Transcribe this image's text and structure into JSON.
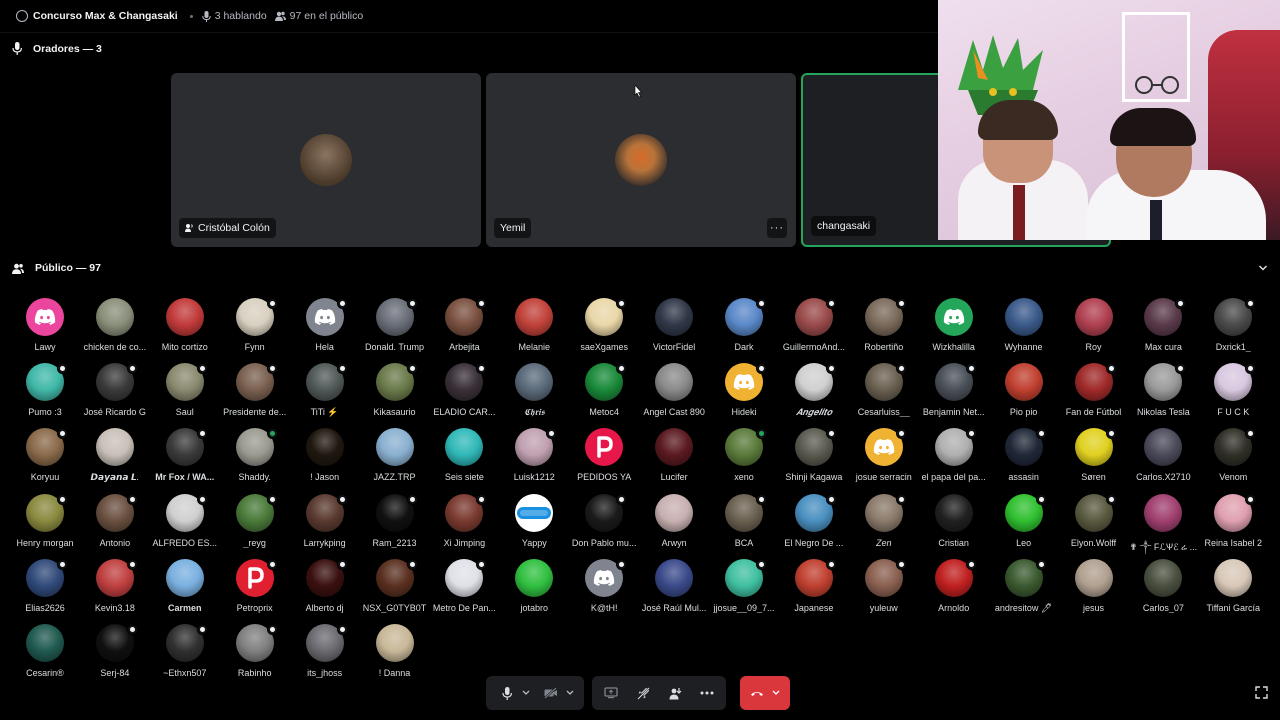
{
  "stage": {
    "title": "Concurso Max & Changasaki",
    "speaking": "3 hablando",
    "audience": "97 en el público"
  },
  "speakers_header": "Oradores — 3",
  "audience_header": "Público — 97",
  "speakers": [
    {
      "name": "Cristóbal Colón",
      "color": "#5a4a3a",
      "has_more": false,
      "active": false
    },
    {
      "name": "Yemil",
      "color": "#b8743a",
      "has_more": true,
      "active": false
    },
    {
      "name": "changasaki",
      "color": "#3a3a3a",
      "has_more": false,
      "active": true
    }
  ],
  "audience": [
    {
      "name": "Lawy",
      "color": "#eb459e",
      "icon": "discord",
      "badge": "none"
    },
    {
      "name": "chicken de co...",
      "color": "#8a8f7a",
      "icon": "photo",
      "badge": "none"
    },
    {
      "name": "Mito cortizo",
      "color": "#c23a3a",
      "icon": "photo",
      "badge": "none"
    },
    {
      "name": "Fynn",
      "color": "#d8d0c0",
      "icon": "photo",
      "badge": "muted"
    },
    {
      "name": "Hela",
      "color": "#80848e",
      "icon": "discord",
      "badge": "muted"
    },
    {
      "name": "Donald. Trump",
      "color": "#6a6e78",
      "icon": "photo",
      "badge": "muted"
    },
    {
      "name": "Arbejita",
      "color": "#7a5040",
      "icon": "photo",
      "badge": "muted"
    },
    {
      "name": "Melanie",
      "color": "#c0423a",
      "icon": "photo",
      "badge": "none"
    },
    {
      "name": "saeXgames",
      "color": "#e9d7a8",
      "icon": "photo",
      "badge": "muted"
    },
    {
      "name": "VictorFidel",
      "color": "#303848",
      "icon": "photo",
      "badge": "none"
    },
    {
      "name": "Dark",
      "color": "#5a88c8",
      "icon": "photo",
      "badge": "muted"
    },
    {
      "name": "GuillermoAnd...",
      "color": "#9a4a4a",
      "icon": "photo",
      "badge": "muted"
    },
    {
      "name": "Robertiño",
      "color": "#7a6a5a",
      "icon": "photo",
      "badge": "muted"
    },
    {
      "name": "Wizkhalilla",
      "color": "#23a55a",
      "icon": "discord",
      "badge": "none"
    },
    {
      "name": "Wyhanne",
      "color": "#3a5a8a",
      "icon": "photo",
      "badge": "none"
    },
    {
      "name": "Roy",
      "color": "#b04050",
      "icon": "photo",
      "badge": "none"
    },
    {
      "name": "Max cura",
      "color": "#5a3a4a",
      "icon": "photo",
      "badge": "muted"
    },
    {
      "name": "Dxrick1_",
      "color": "#4a4a4a",
      "icon": "photo",
      "badge": "muted"
    },
    {
      "name": "Pumo :3",
      "color": "#40b8a8",
      "icon": "photo",
      "badge": "muted"
    },
    {
      "name": "José Ricardo G",
      "color": "#3a3a3a",
      "icon": "photo",
      "badge": "muted"
    },
    {
      "name": "Saul",
      "color": "#8a8a70",
      "icon": "photo",
      "badge": "muted"
    },
    {
      "name": "Presidente de...",
      "color": "#7a6050",
      "icon": "photo",
      "badge": "muted"
    },
    {
      "name": "TiTi ⚡",
      "color": "#505858",
      "icon": "photo",
      "badge": "muted"
    },
    {
      "name": "Kikasaurio",
      "color": "#6a7a4a",
      "icon": "photo",
      "badge": "muted"
    },
    {
      "name": "ELADIO CAR...",
      "color": "#3a3038",
      "icon": "photo",
      "badge": "muted"
    },
    {
      "name": "𝕮𝖍𝖗𝖎𝖘",
      "color": "#5a6a7a",
      "icon": "photo",
      "badge": "none"
    },
    {
      "name": "Metoc4",
      "color": "#1a8a3a",
      "icon": "photo",
      "badge": "muted"
    },
    {
      "name": "Angel Cast 890",
      "color": "#8a8a8a",
      "icon": "photo",
      "badge": "none"
    },
    {
      "name": "Hideki",
      "color": "#f0b232",
      "icon": "discord",
      "badge": "muted"
    },
    {
      "name": "𝑨𝒏𝒈𝒆𝒍𝒊𝒕𝒐",
      "color": "#d0d0d0",
      "icon": "photo",
      "badge": "muted"
    },
    {
      "name": "Cesarluiss__",
      "color": "#6a6050",
      "icon": "photo",
      "badge": "muted"
    },
    {
      "name": "Benjamin Net...",
      "color": "#4a5058",
      "icon": "photo",
      "badge": "muted"
    },
    {
      "name": "Pio pio",
      "color": "#c04030",
      "icon": "photo",
      "badge": "none"
    },
    {
      "name": "Fan de Fútbol",
      "color": "#a02a2a",
      "icon": "photo",
      "badge": "muted"
    },
    {
      "name": "Nikolas Tesla",
      "color": "#9a9a9a",
      "icon": "photo",
      "badge": "muted"
    },
    {
      "name": "F U C K",
      "color": "#d8c8e0",
      "icon": "photo",
      "badge": "muted"
    },
    {
      "name": "Koryuu",
      "color": "#8a6a4a",
      "icon": "photo",
      "badge": "muted"
    },
    {
      "name": "𝘿𝙖𝙮𝙖𝙣𝙖 𝙇.",
      "color": "#c8c0b8",
      "icon": "photo",
      "badge": "none"
    },
    {
      "name": "Mr Fox / WA...",
      "color": "#3a3a3a",
      "icon": "photo",
      "badge": "muted"
    },
    {
      "name": "Shaddy.",
      "color": "#9a9a90",
      "icon": "photo",
      "badge": "green"
    },
    {
      "name": "! Jason",
      "color": "#201810",
      "icon": "photo",
      "badge": "none"
    },
    {
      "name": "JAZZ.TRP",
      "color": "#8ab0d0",
      "icon": "photo",
      "badge": "none"
    },
    {
      "name": "Seis siete",
      "color": "#30b8b8",
      "icon": "photo",
      "badge": "none"
    },
    {
      "name": "Luisk1212",
      "color": "#c0a0b0",
      "icon": "photo",
      "badge": "muted"
    },
    {
      "name": "PEDIDOS YA",
      "color": "#e8174a",
      "icon": "letter-p",
      "badge": "none"
    },
    {
      "name": "Lucifer",
      "color": "#5a1a20",
      "icon": "photo",
      "badge": "none"
    },
    {
      "name": "xeno",
      "color": "#5a7a3a",
      "icon": "photo",
      "badge": "green"
    },
    {
      "name": "Shinji Kagawa",
      "color": "#5a5a50",
      "icon": "photo",
      "badge": "muted"
    },
    {
      "name": "josue serracin",
      "color": "#f0b232",
      "icon": "discord",
      "badge": "muted"
    },
    {
      "name": "el papa del pa...",
      "color": "#b0b0b0",
      "icon": "photo",
      "badge": "muted"
    },
    {
      "name": "assasin",
      "color": "#202838",
      "icon": "photo",
      "badge": "muted"
    },
    {
      "name": "Søren",
      "color": "#e0d020",
      "icon": "photo",
      "badge": "muted"
    },
    {
      "name": "Carlos.X2710",
      "color": "#4a4a5a",
      "icon": "photo",
      "badge": "none"
    },
    {
      "name": "Venom",
      "color": "#303028",
      "icon": "photo",
      "badge": "muted"
    },
    {
      "name": "Henry morgan",
      "color": "#8a8a40",
      "icon": "photo",
      "badge": "muted"
    },
    {
      "name": "Antonio",
      "color": "#6a5040",
      "icon": "photo",
      "badge": "muted"
    },
    {
      "name": "ALFREDO ES...",
      "color": "#d0d0d0",
      "icon": "photo",
      "badge": "muted"
    },
    {
      "name": "_reyg",
      "color": "#4a7a3a",
      "icon": "photo",
      "badge": "muted"
    },
    {
      "name": "Larrykping",
      "color": "#5a3a30",
      "icon": "photo",
      "badge": "muted"
    },
    {
      "name": "Ram_2213",
      "color": "#101010",
      "icon": "photo",
      "badge": "muted"
    },
    {
      "name": "Xi Jimping",
      "color": "#7a3a30",
      "icon": "photo",
      "badge": "muted"
    },
    {
      "name": "Yappy",
      "color": "#ffffff",
      "icon": "yappy",
      "badge": "none"
    },
    {
      "name": "Don Pablo mu...",
      "color": "#1a1a1a",
      "icon": "photo",
      "badge": "muted"
    },
    {
      "name": "Arwyn",
      "color": "#c8b0b0",
      "icon": "photo",
      "badge": "none"
    },
    {
      "name": "BCA",
      "color": "#6a6050",
      "icon": "photo",
      "badge": "muted"
    },
    {
      "name": "El Negro De ...",
      "color": "#4a90c0",
      "icon": "photo",
      "badge": "muted"
    },
    {
      "name": "Zen",
      "color": "#8a7a6a",
      "icon": "photo",
      "badge": "muted"
    },
    {
      "name": "Cristian",
      "color": "#202020",
      "icon": "photo",
      "badge": "none"
    },
    {
      "name": "Leo",
      "color": "#30c030",
      "icon": "photo",
      "badge": "muted"
    },
    {
      "name": "Elyon.Wolff",
      "color": "#5a5a40",
      "icon": "photo",
      "badge": "muted"
    },
    {
      "name": "✟ ༒ FℒѰℰ ሬ ...",
      "color": "#a04070",
      "icon": "photo",
      "badge": "none"
    },
    {
      "name": "Reina Isabel 2",
      "color": "#e0a0b0",
      "icon": "photo",
      "badge": "muted"
    },
    {
      "name": "Elias2626",
      "color": "#304a7a",
      "icon": "photo",
      "badge": "muted"
    },
    {
      "name": "Kevin3.18",
      "color": "#c04040",
      "icon": "photo",
      "badge": "muted"
    },
    {
      "name": "Carmen",
      "color": "#7ab0e0",
      "icon": "photo",
      "badge": "none"
    },
    {
      "name": "Petroprix",
      "color": "#e02030",
      "icon": "letter-p",
      "badge": "muted"
    },
    {
      "name": "Alberto dj",
      "color": "#3a1010",
      "icon": "photo",
      "badge": "muted"
    },
    {
      "name": "NSX_G0TYB0T",
      "color": "#5a3020",
      "icon": "photo",
      "badge": "muted"
    },
    {
      "name": "Metro De Pan...",
      "color": "#e0e0e8",
      "icon": "photo",
      "badge": "muted"
    },
    {
      "name": "jotabro",
      "color": "#30c040",
      "icon": "photo",
      "badge": "none"
    },
    {
      "name": "K@tH!",
      "color": "#80848e",
      "icon": "discord",
      "badge": "muted"
    },
    {
      "name": "José Raúl Mul...",
      "color": "#3a4a8a",
      "icon": "photo",
      "badge": "none"
    },
    {
      "name": "jjosue__09_7...",
      "color": "#40c0a0",
      "icon": "photo",
      "badge": "muted"
    },
    {
      "name": "Japanese",
      "color": "#c04030",
      "icon": "photo",
      "badge": "muted"
    },
    {
      "name": "yuleuw",
      "color": "#8a6050",
      "icon": "photo",
      "badge": "muted"
    },
    {
      "name": "Arnoldo",
      "color": "#c02020",
      "icon": "photo",
      "badge": "muted"
    },
    {
      "name": "andresitow 🖊",
      "color": "#3a5a30",
      "icon": "photo",
      "badge": "muted"
    },
    {
      "name": "jesus",
      "color": "#b0a090",
      "icon": "photo",
      "badge": "none"
    },
    {
      "name": "Carlos_07",
      "color": "#4a5040",
      "icon": "photo",
      "badge": "none"
    },
    {
      "name": "Tiffani García",
      "color": "#d8c8b8",
      "icon": "photo",
      "badge": "none"
    },
    {
      "name": "Cesarin®",
      "color": "#205a50",
      "icon": "photo",
      "badge": "none"
    },
    {
      "name": "Serj-84",
      "color": "#101010",
      "icon": "photo",
      "badge": "muted"
    },
    {
      "name": "~Ethxn507",
      "color": "#303030",
      "icon": "photo",
      "badge": "muted"
    },
    {
      "name": "Rabinho",
      "color": "#808080",
      "icon": "photo",
      "badge": "muted"
    },
    {
      "name": "its_jhoss",
      "color": "#6a6a70",
      "icon": "photo",
      "badge": "muted"
    },
    {
      "name": "! Danna",
      "color": "#c8b898",
      "icon": "photo",
      "badge": "none"
    }
  ],
  "colors": {
    "accent_green": "#23a55a",
    "hangup_red": "#da373c",
    "tile_bg": "#2b2d31"
  }
}
